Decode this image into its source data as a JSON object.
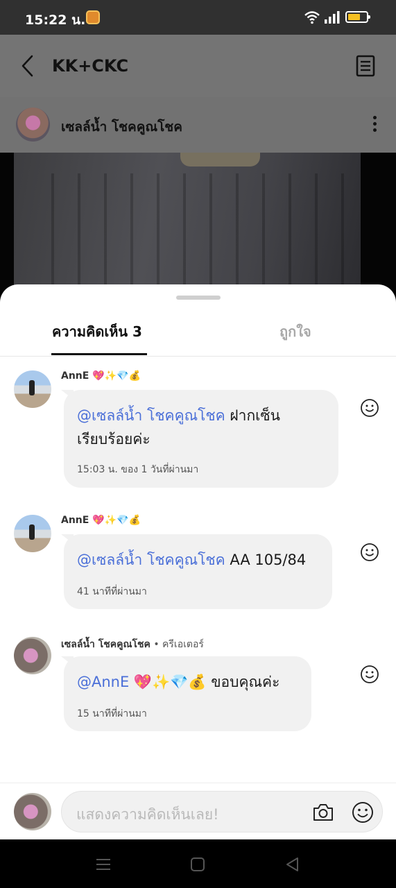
{
  "status_bar": {
    "time": "15:22 น.",
    "icons": [
      "app-notification-icon",
      "wifi-icon",
      "signal-icon",
      "battery-icon"
    ],
    "battery_color": "#f5c021"
  },
  "header": {
    "title": "KK+CKC",
    "back_icon": "chevron-left-icon",
    "menu_icon": "document-icon"
  },
  "post": {
    "author_name": "เซลล์น้ำ โชคคูณโชค"
  },
  "sheet": {
    "tabs": [
      {
        "label": "ความคิดเห็น 3",
        "active": true
      },
      {
        "label": "ถูกใจ",
        "active": false
      }
    ]
  },
  "comments": [
    {
      "author": "AnnE",
      "author_emoji": "💖✨💎💰",
      "tag": "",
      "mention": "@เซลล์น้ำ โชคคูณโชค",
      "text_line1": " ฝากเซ็น",
      "text_line2": "เรียบร้อยค่ะ",
      "time": "15:03 น. ของ 1 วันที่ผ่านมา"
    },
    {
      "author": "AnnE",
      "author_emoji": "💖✨💎💰",
      "tag": "",
      "mention": "@เซลล์น้ำ โชคคูณโชค",
      "text_line1": " AA 105/84",
      "text_line2": "",
      "time": "41 นาทีที่ผ่านมา"
    },
    {
      "author": "เซลล์น้ำ โชคคูณโชค",
      "author_emoji": "",
      "tag": " • ครีเอเตอร์",
      "mention": "@AnnE 💖✨💎💰",
      "text_line1": " ขอบคุณค่ะ",
      "text_line2": "",
      "time": "15 นาทีที่ผ่านมา"
    }
  ],
  "composer": {
    "placeholder": "แสดงความคิดเห็นเลย!",
    "icons": [
      "camera-icon",
      "emoji-icon"
    ]
  },
  "colors": {
    "mention": "#4a6fd8",
    "bubble": "#f1f1f1"
  }
}
